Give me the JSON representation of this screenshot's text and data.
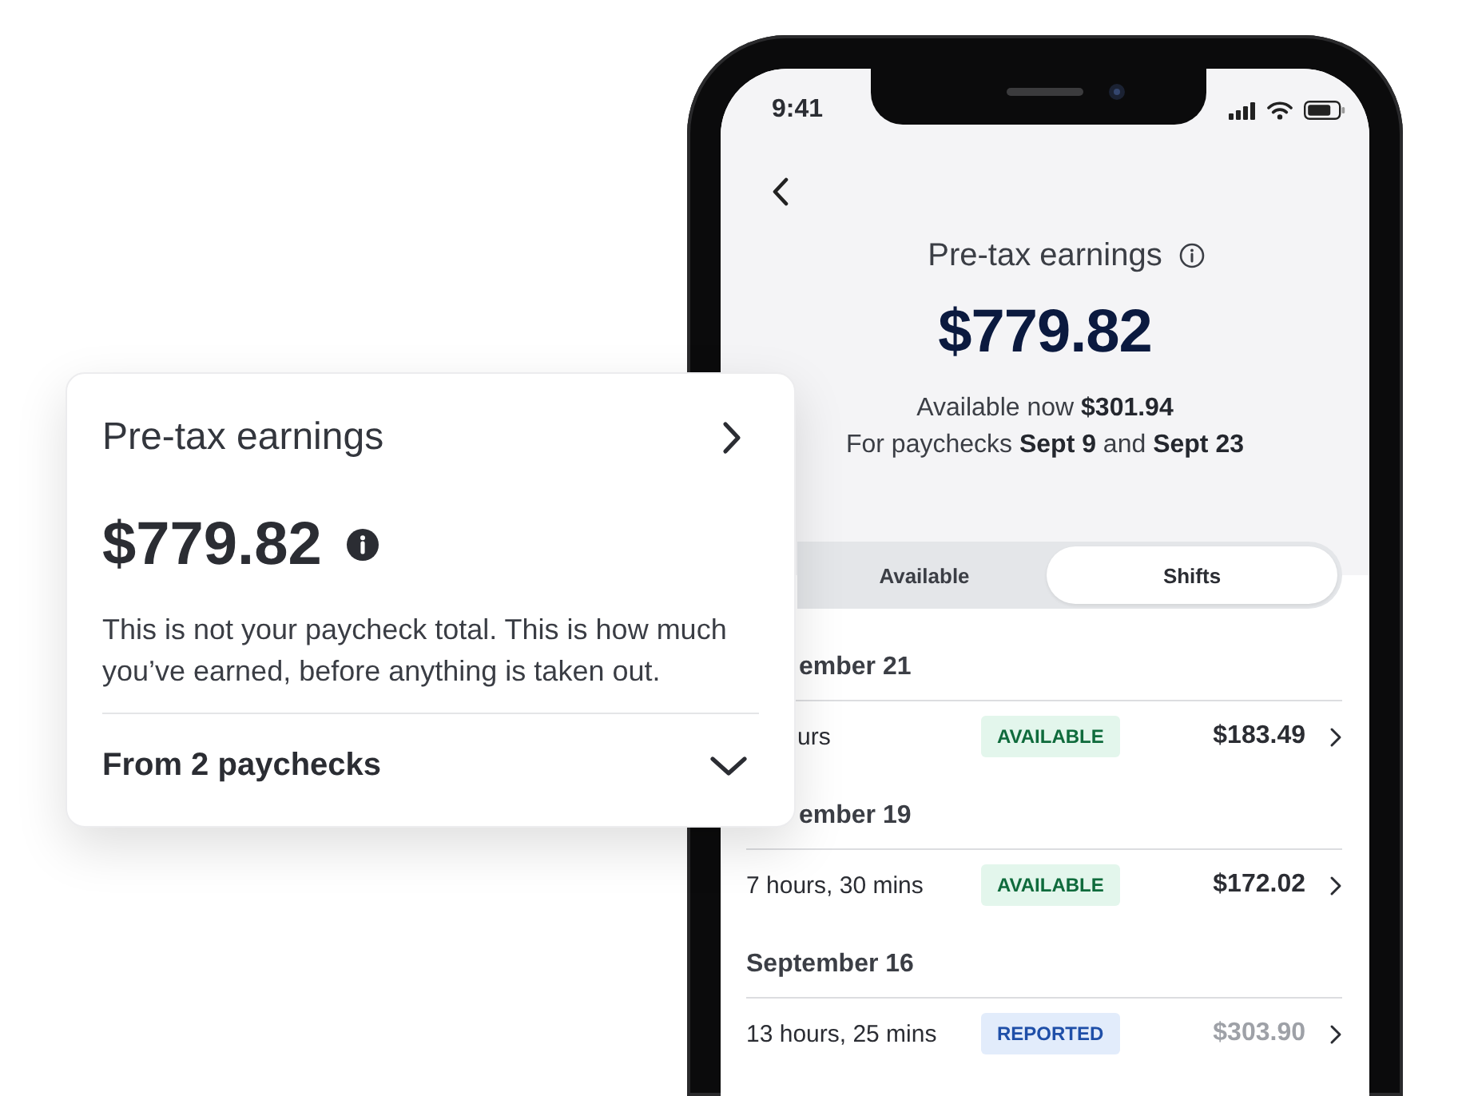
{
  "phone": {
    "status_bar": {
      "time": "9:41"
    },
    "header": {
      "title": "Pre-tax earnings",
      "amount": "$779.82",
      "available_line": "Available now **$301.94**",
      "paychecks_line": "For paychecks **Sept 9** and **Sept 23**"
    },
    "tabs": [
      {
        "label": "Available",
        "selected": false
      },
      {
        "label": "Shifts",
        "selected": true
      }
    ],
    "shift_groups": [
      {
        "date": "ember 21",
        "shifts": [
          {
            "duration": "urs",
            "status": {
              "kind": "available",
              "label": "AVAILABLE"
            },
            "amount": "$183.49"
          }
        ]
      },
      {
        "date": "ember 19",
        "shifts": [
          {
            "duration": "7 hours, 30 mins",
            "status": {
              "kind": "available",
              "label": "AVAILABLE"
            },
            "amount": "$172.02"
          }
        ]
      },
      {
        "date": "September 16",
        "shifts": [
          {
            "duration": "13 hours, 25 mins",
            "status": {
              "kind": "reported",
              "label": "REPORTED"
            },
            "amount": "$303.90"
          }
        ]
      }
    ]
  },
  "earnings_card": {
    "title": "Pre-tax earnings",
    "amount": "$779.82",
    "description": "This is not your paycheck total. This is how much you’ve earned, before anything is taken out.",
    "footer": {
      "label": "From 2 paychecks",
      "expanded": false
    }
  }
}
